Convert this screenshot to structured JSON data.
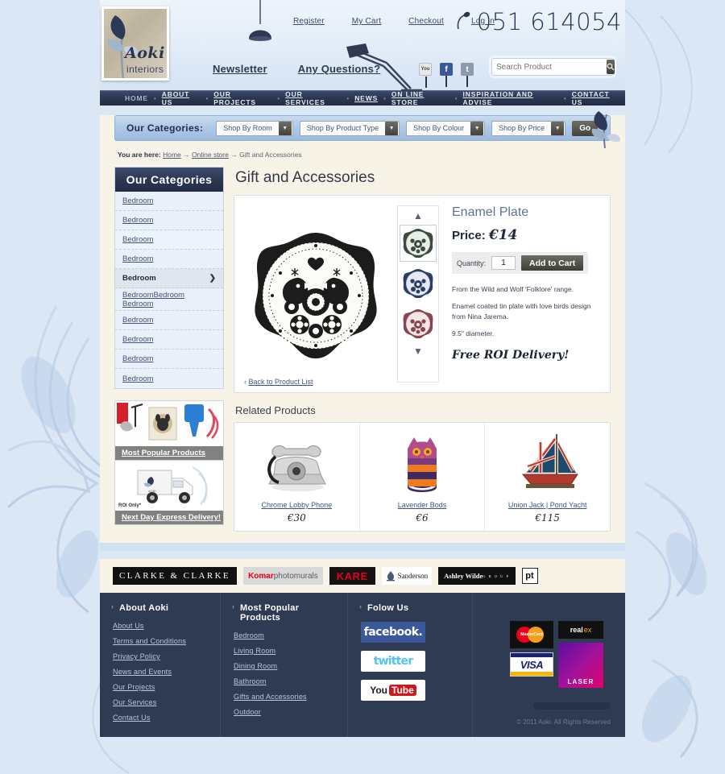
{
  "site": {
    "logo_name": "Aoki",
    "logo_sub": "interiors",
    "phone": "051 614054"
  },
  "header": {
    "top_links": [
      "Register",
      "My Cart",
      "Checkout",
      "Log In"
    ],
    "mid_links": [
      "Newsletter",
      "Any Questions?"
    ],
    "social_icons": [
      "youtube-icon",
      "facebook-icon",
      "twitter-icon"
    ],
    "search": {
      "placeholder": "Search Product",
      "value": "",
      "icon": "search-icon"
    }
  },
  "nav": {
    "items": [
      {
        "label": "HOME",
        "active": true
      },
      {
        "label": "ABOUT US",
        "active": false
      },
      {
        "label": "OUR PROJECTS",
        "active": false
      },
      {
        "label": "OUR SERVICES",
        "active": false
      },
      {
        "label": "NEWS",
        "active": false
      },
      {
        "label": "ON LINE STORE",
        "active": false
      },
      {
        "label": "INSPIRATION AND ADVISE",
        "active": false
      },
      {
        "label": "CONTACT US",
        "active": false
      }
    ]
  },
  "category_bar": {
    "title": "Our Categories:",
    "selects": [
      "Shop By Room",
      "Shop By Product Type",
      "Shop By Colour",
      "Shop By Price"
    ],
    "go_label": "Go"
  },
  "breadcrumb": {
    "prefix": "You are here:",
    "items": [
      "Home",
      "Online store",
      "Gift and Accessories"
    ],
    "separator": "→"
  },
  "sidebar": {
    "heading": "Our Categories",
    "items": [
      {
        "label": "Bedroom",
        "state": "normal"
      },
      {
        "label": "Bedroom",
        "state": "normal"
      },
      {
        "label": "Bedroom",
        "state": "highlight"
      },
      {
        "label": "Bedroom",
        "state": "normal"
      },
      {
        "label": "Bedroom",
        "state": "selected"
      },
      {
        "label": "BedroomBedroom Bedroom",
        "state": "normal"
      },
      {
        "label": "Bedroom",
        "state": "normal"
      },
      {
        "label": "Bedroom",
        "state": "normal"
      },
      {
        "label": "Bedroom",
        "state": "normal"
      },
      {
        "label": "Bedroom",
        "state": "normal"
      }
    ],
    "promos": [
      {
        "caption": "Most Popular Products"
      },
      {
        "caption": "Next Day Express Delivery!",
        "note": "ROI Only*"
      }
    ]
  },
  "main": {
    "page_title": "Gift and Accessories",
    "product": {
      "name": "Enamel Plate",
      "price_label": "Price:",
      "price": "€14",
      "quantity_label": "Quantity:",
      "quantity_value": "1",
      "add_to_cart": "Add to Cart",
      "description": [
        "From the Wild and Wolf 'Folklore' range.",
        "Enamel coated tin plate with love birds design from Nina Jarema.",
        "9.5\" diameter."
      ],
      "promo_text": "Free ROI Delivery!",
      "back_link": "Back to Product List",
      "thumbnails": [
        {
          "name": "plate-green-thumb",
          "color": "#3d4a3f",
          "bg": "#e8ede7",
          "active": true
        },
        {
          "name": "plate-blue-thumb",
          "color": "#2b3f66",
          "bg": "#e4eaf4",
          "active": false
        },
        {
          "name": "plate-pink-thumb",
          "color": "#8a4550",
          "bg": "#f4e6e7",
          "active": false
        }
      ],
      "carousel_up": "▲",
      "carousel_down": "▼"
    },
    "related": {
      "heading": "Related Products",
      "items": [
        {
          "name": "Chrome Lobby Phone",
          "price": "€30",
          "icon": "telephone-icon"
        },
        {
          "name": "Lavender Bods",
          "price": "€6",
          "icon": "knitted-owl-icon"
        },
        {
          "name": "Union Jack | Pond Yacht",
          "price": "€115",
          "icon": "sailboat-icon"
        }
      ]
    }
  },
  "brands": [
    {
      "name": "CLARKE & CLARKE",
      "style": "clarke"
    },
    {
      "name": "Komar photomurals",
      "bold": "Komar",
      "rest": " photomurals",
      "style": "komar"
    },
    {
      "name": "KARE",
      "style": "kare"
    },
    {
      "name": "Sanderson",
      "style": "sanderson"
    },
    {
      "name": "Ashley Wilde",
      "sub": "G R O U P",
      "style": "ashley"
    },
    {
      "name": "pt",
      "style": "pt"
    }
  ],
  "footer": {
    "columns": [
      {
        "heading": "About Aoki",
        "links": [
          "About Us",
          "Terms and Conditions",
          "Privacy Policy",
          "News and Events",
          "Our Projects",
          "Our Services",
          "Contact Us"
        ]
      },
      {
        "heading": "Most Popular Products",
        "links": [
          "Bedroom",
          "Living Room",
          "Dining Room",
          "Bathroom",
          "Gifts and Accessories",
          "Outdoor"
        ]
      },
      {
        "heading": "Folow Us",
        "social": [
          {
            "label": "facebook.",
            "name": "facebook-button"
          },
          {
            "label": "twitter",
            "name": "twitter-button"
          },
          {
            "label_you": "You",
            "label_tube": "Tube",
            "name": "youtube-button"
          }
        ]
      }
    ],
    "payments": [
      "MasterCard",
      "VISA",
      "realex",
      "LASER"
    ],
    "copyright": "© 2011 Aoki. All Rights Reserved"
  },
  "colors": {
    "page_bg": "#dce7f5",
    "cream": "#f7f3e7",
    "navy": "#2b3751",
    "link": "#44537a",
    "accent_blue": "#5b7594"
  }
}
